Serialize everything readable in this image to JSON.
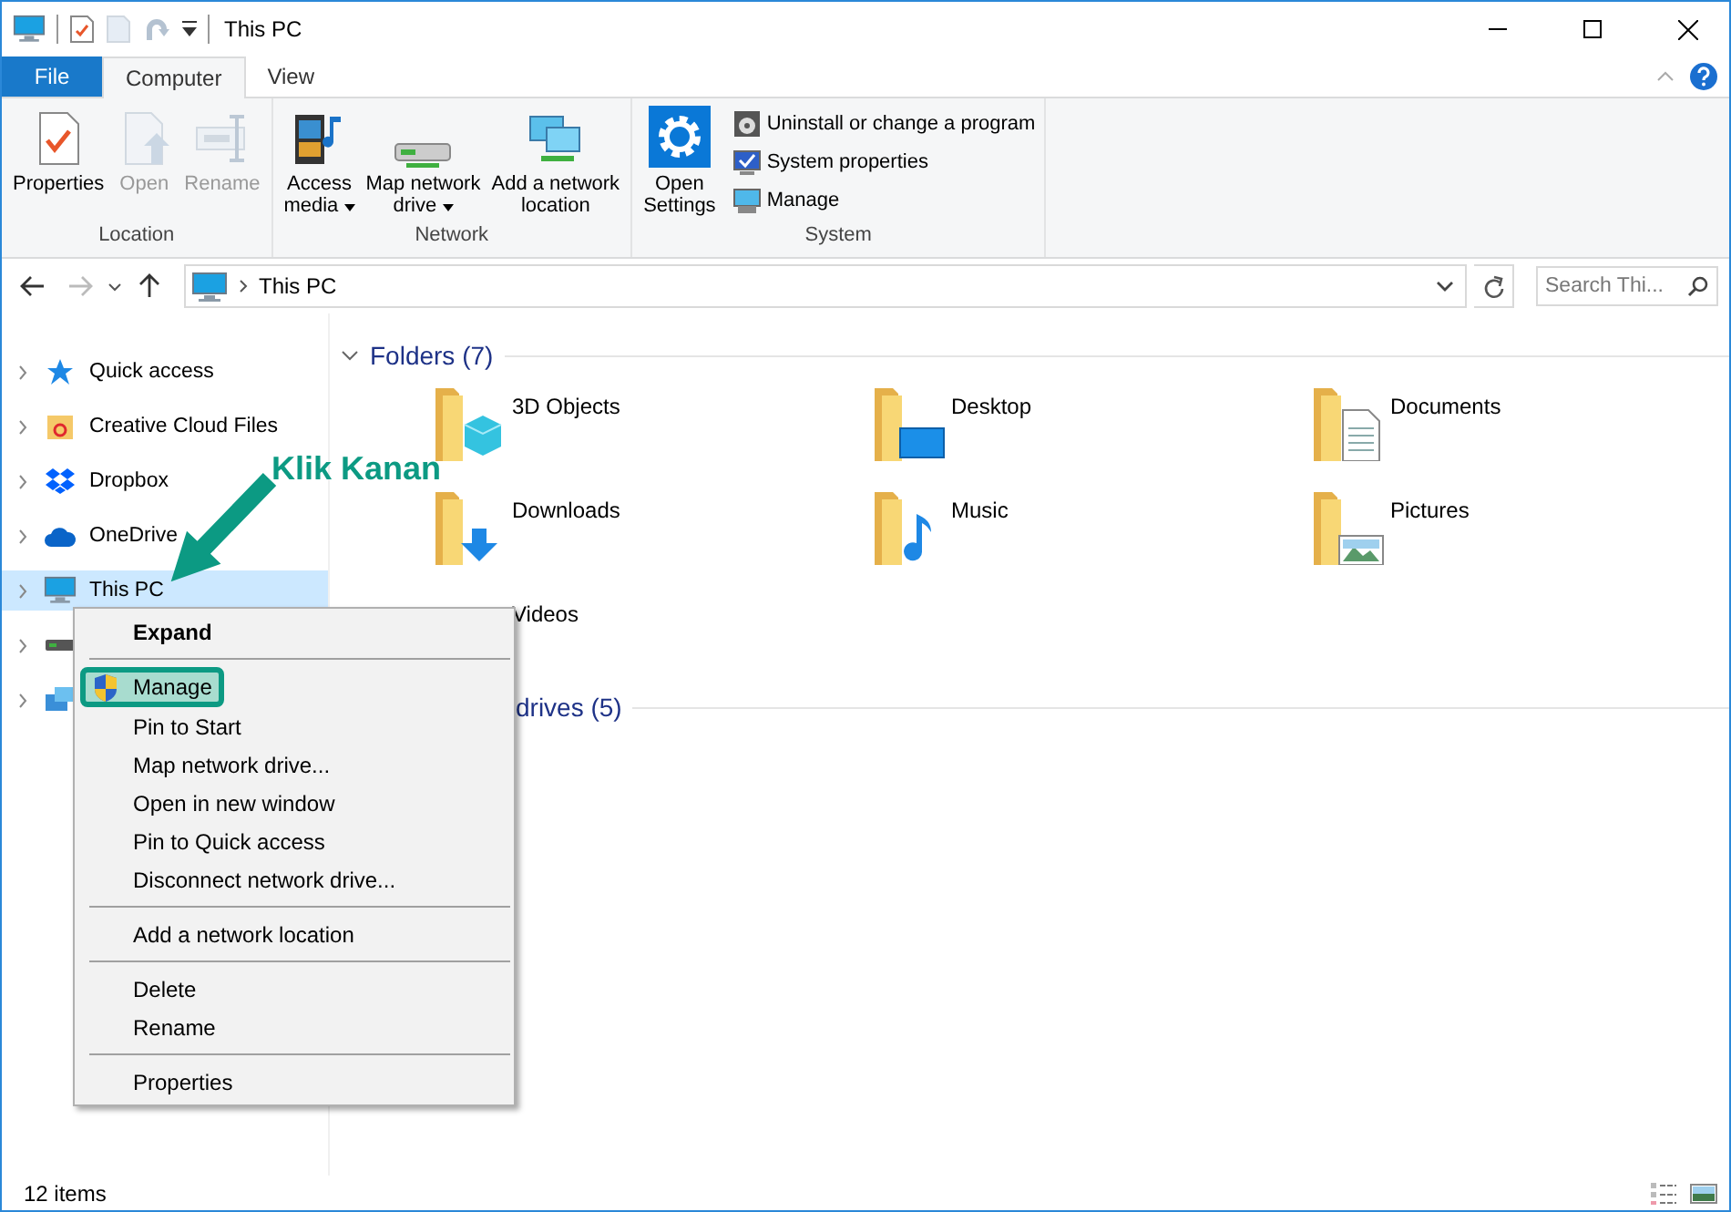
{
  "window": {
    "title": "This PC"
  },
  "quick_access": [
    {
      "kind": "properties",
      "disabled": false
    },
    {
      "kind": "new-folder",
      "disabled": true
    },
    {
      "kind": "undo",
      "disabled": true
    }
  ],
  "tabs": [
    {
      "label": "File",
      "kind": "file",
      "selected": false
    },
    {
      "label": "Computer",
      "kind": "tab",
      "selected": true
    },
    {
      "label": "View",
      "kind": "tab",
      "selected": false
    }
  ],
  "ribbon": {
    "groups": [
      {
        "label": "Location",
        "buttons": [
          {
            "kind": "properties",
            "lines": [
              "Properties"
            ],
            "disabled": false,
            "dropdown": false
          },
          {
            "kind": "open",
            "lines": [
              "Open"
            ],
            "disabled": true,
            "dropdown": false
          },
          {
            "kind": "rename",
            "lines": [
              "Rename"
            ],
            "disabled": true,
            "dropdown": false
          }
        ]
      },
      {
        "label": "Network",
        "buttons": [
          {
            "kind": "media",
            "lines": [
              "Access",
              "media"
            ],
            "disabled": false,
            "dropdown": true
          },
          {
            "kind": "map-drive",
            "lines": [
              "Map network",
              "drive"
            ],
            "disabled": false,
            "dropdown": true
          },
          {
            "kind": "network-location",
            "lines": [
              "Add a network",
              "location"
            ],
            "disabled": false,
            "dropdown": false
          }
        ]
      },
      {
        "label": "System",
        "buttons": [
          {
            "kind": "settings",
            "lines": [
              "Open",
              "Settings"
            ],
            "disabled": false,
            "dropdown": false
          }
        ],
        "small_buttons": [
          {
            "kind": "uninstall",
            "label": "Uninstall or change a program"
          },
          {
            "kind": "system-properties",
            "label": "System properties"
          },
          {
            "kind": "manage",
            "label": "Manage"
          }
        ]
      }
    ]
  },
  "address": {
    "back_disabled": false,
    "forward_disabled": true,
    "path": [
      "This PC"
    ],
    "search": {
      "placeholder": "Search Thi..."
    }
  },
  "sidebar": {
    "items": [
      {
        "label": "Quick access",
        "kind": "star",
        "selected": false
      },
      {
        "label": "Creative Cloud Files",
        "kind": "cloud-files",
        "selected": false
      },
      {
        "label": "Dropbox",
        "kind": "dropbox",
        "selected": false
      },
      {
        "label": "OneDrive",
        "kind": "onedrive",
        "selected": false
      },
      {
        "label": "This PC",
        "kind": "pc",
        "selected": true
      },
      {
        "kind": "drive",
        "selected": false
      },
      {
        "kind": "network",
        "selected": false
      }
    ]
  },
  "content": {
    "sections": [
      {
        "title": "Folders (7)",
        "kind": "group",
        "items": [
          {
            "label": "3D Objects",
            "kind": "objects"
          },
          {
            "label": "Desktop",
            "kind": "desktop"
          },
          {
            "label": "Documents",
            "kind": "documents"
          },
          {
            "label": "Downloads",
            "kind": "downloads"
          },
          {
            "label": "Music",
            "kind": "music"
          },
          {
            "label": "Pictures",
            "kind": "pictures"
          },
          {
            "label": "Videos"
          }
        ]
      },
      {
        "title": "drives (5)",
        "kind": "covered"
      }
    ]
  },
  "context_menu": {
    "groups": [
      [
        {
          "label": "Expand",
          "kind": "plain",
          "default": true,
          "highlighted": false
        }
      ],
      [
        {
          "label": "Manage",
          "kind": "shield",
          "default": false,
          "highlighted": true
        },
        {
          "label": "Pin to Start",
          "kind": "plain",
          "default": false,
          "highlighted": false
        },
        {
          "label": "Map network drive...",
          "kind": "plain",
          "default": false,
          "highlighted": false
        },
        {
          "label": "Open in new window",
          "kind": "plain",
          "default": false,
          "highlighted": false
        },
        {
          "label": "Pin to Quick access",
          "kind": "plain",
          "default": false,
          "highlighted": false
        },
        {
          "label": "Disconnect network drive...",
          "kind": "plain",
          "default": false,
          "highlighted": false
        }
      ],
      [
        {
          "label": "Add a network location",
          "kind": "plain",
          "default": false,
          "highlighted": false
        }
      ],
      [
        {
          "label": "Delete",
          "kind": "plain",
          "default": false,
          "highlighted": false
        },
        {
          "label": "Rename",
          "kind": "plain",
          "default": false,
          "highlighted": false
        }
      ],
      [
        {
          "label": "Properties",
          "kind": "plain",
          "default": false,
          "highlighted": false
        }
      ]
    ]
  },
  "annotation": {
    "text": "Klik Kanan"
  },
  "status_bar": {
    "text": "12 items"
  }
}
